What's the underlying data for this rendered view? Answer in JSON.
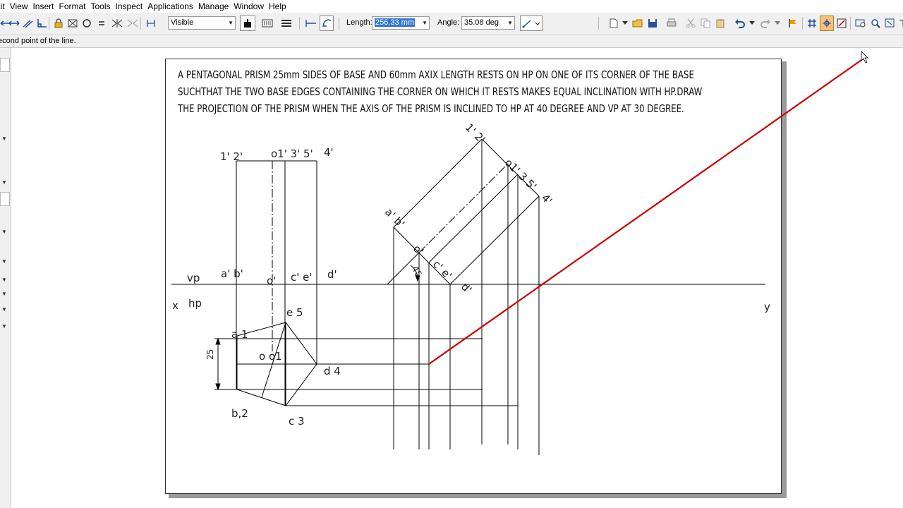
{
  "menubar": {
    "items": [
      "lit",
      "View",
      "Insert",
      "Format",
      "Tools",
      "Inspect",
      "Applications",
      "Manage",
      "Window",
      "Help"
    ]
  },
  "toolbar": {
    "line_style_value": "Visible",
    "length_label": "Length:",
    "length_value": "256.33 mm",
    "angle_label": "Angle:",
    "angle_value": "35.08 deg"
  },
  "status": {
    "prompt": "econd point of the line."
  },
  "problem": {
    "lines": [
      "A PENTAGONAL PRISM 25mm SIDES OF BASE AND 60mm AXIX LENGTH RESTS ON HP ON ONE OF ITS CORNER OF THE BASE",
      "SUCHTHAT THE TWO BASE EDGES CONTAINING THE CORNER ON WHICH IT RESTS MAKES EQUAL INCLINATION WITH HP.DRAW",
      "THE PROJECTION OF THE PRISM WHEN THE AXIS OF THE PRISM IS INCLINED TO HP AT 40 DEGREE AND VP AT 30 DEGREE."
    ]
  },
  "labels": {
    "front_top_left": "1' 2'",
    "front_top_mid": "o1' 3' 5'",
    "front_top_right": "4'",
    "vp": "vp",
    "hp": "hp",
    "x": "x",
    "y": "y",
    "front_base_ab": "a' b'",
    "front_base_o": "o'",
    "front_base_ce": "c' e'",
    "front_base_d": "d'",
    "top_e5": "e 5",
    "top_a1": "a 1",
    "top_oo1": "o o1",
    "top_d4": "d 4",
    "top_b2": "b,2",
    "top_c3": "c 3",
    "dim_25": "25",
    "tilt_12": "1' 2'",
    "tilt_o135": "o1' 3 5'",
    "tilt_4": "4'",
    "tilt_ab": "a' b'",
    "tilt_o": "o'",
    "tilt_ce": "c' e'",
    "tilt_d": "d'",
    "tilt_angle": "45"
  },
  "colors": {
    "active_line": "#cc0000",
    "drawing_line": "#000000",
    "toolbar_bg": "#f0f0f0",
    "selection": "#3276d9"
  }
}
